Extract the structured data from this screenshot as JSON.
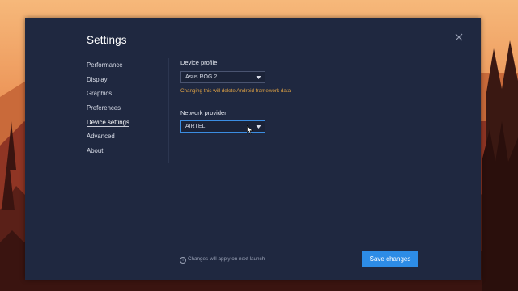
{
  "dialog": {
    "title": "Settings"
  },
  "nav": {
    "items": [
      {
        "label": "Performance"
      },
      {
        "label": "Display"
      },
      {
        "label": "Graphics"
      },
      {
        "label": "Preferences"
      },
      {
        "label": "Device settings"
      },
      {
        "label": "Advanced"
      },
      {
        "label": "About"
      }
    ],
    "active": "Device settings"
  },
  "device_profile": {
    "label": "Device profile",
    "value": "Asus ROG 2",
    "warning": "Changing this will delete Android framework data"
  },
  "network_provider": {
    "label": "Network provider",
    "value": "AIRTEL"
  },
  "footer": {
    "note": "Changes will apply on next launch",
    "save_label": "Save changes"
  },
  "colors": {
    "dialog_bg": "#1f2840",
    "accent": "#2d8ce6",
    "warning": "#e2a444"
  },
  "icons": [
    "close-icon",
    "chevron-down-icon",
    "info-icon",
    "mouse-cursor-icon"
  ]
}
